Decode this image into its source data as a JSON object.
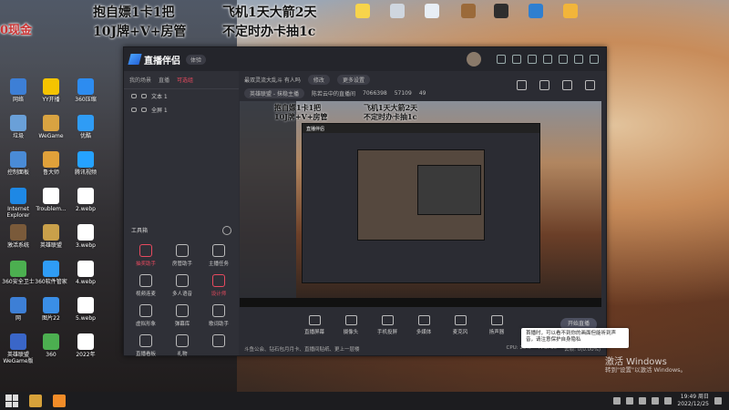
{
  "promo": {
    "line1a": "抱自嫖1卡1把",
    "line1b": "飞机1天大箭2天",
    "line2a": "10J牌+V+房管",
    "line2b": "不定时办卡抽1c",
    "corner": "0现金"
  },
  "desktop_icons": [
    {
      "label": "网络",
      "color": "#3d7fd6"
    },
    {
      "label": "YY开播",
      "color": "#f5c400"
    },
    {
      "label": "360压缩",
      "color": "#2d8cf0"
    },
    {
      "label": "垃圾",
      "color": "#6aa0d8"
    },
    {
      "label": "WeGame",
      "color": "#d9a341"
    },
    {
      "label": "优酷",
      "color": "#2f9cf5"
    },
    {
      "label": "控制面板",
      "color": "#4a8bd6"
    },
    {
      "label": "鲁大师",
      "color": "#e0a13a"
    },
    {
      "label": "腾讯视频",
      "color": "#25a2ff"
    },
    {
      "label": "Internet Explorer",
      "color": "#1e88e5"
    },
    {
      "label": "Troublem...",
      "color": "#ffffff"
    },
    {
      "label": "2.webp",
      "color": "#ffffff"
    },
    {
      "label": "激活系统",
      "color": "#7a5a3a"
    },
    {
      "label": "英雄联盟",
      "color": "#c9a04a"
    },
    {
      "label": "3.webp",
      "color": "#ffffff"
    },
    {
      "label": "360安全卫士",
      "color": "#4caf50"
    },
    {
      "label": "360软件管家",
      "color": "#2f9cf5"
    },
    {
      "label": "4.webp",
      "color": "#ffffff"
    },
    {
      "label": "网",
      "color": "#3d7fd6"
    },
    {
      "label": "图片22",
      "color": "#3a8ee6"
    },
    {
      "label": "5.webp",
      "color": "#ffffff"
    },
    {
      "label": "英雄联盟WeGame版",
      "color": "#3a66c8"
    },
    {
      "label": "360",
      "color": "#4caf50"
    },
    {
      "label": "2022年",
      "color": "#ffffff"
    }
  ],
  "top_icons": [
    {
      "label": "",
      "color": "#f7d44b"
    },
    {
      "label": "",
      "color": "#cfd6df"
    },
    {
      "label": "",
      "color": "#e8eef5"
    },
    {
      "label": "",
      "color": "#9b6a3a"
    },
    {
      "label": "",
      "color": "#2e2e2e"
    },
    {
      "label": "",
      "color": "#2f7fd0"
    },
    {
      "label": "",
      "color": "#f2b53a"
    },
    {
      "label": "",
      "color": "#f2b53a"
    },
    {
      "label": "",
      "color": "#f2b53a"
    },
    {
      "label": "",
      "color": "#f2b53a"
    },
    {
      "label": "",
      "color": "#ffffff"
    },
    {
      "label": "",
      "color": "#39a845"
    }
  ],
  "app": {
    "name": "直播伴侣",
    "badge": "体验",
    "tabs": [
      "我的场景",
      "直播",
      "可选组"
    ],
    "scenes": [
      "文本 1",
      "全屏 1"
    ],
    "tools_header": "工具箱",
    "tools": [
      {
        "label": "抽奖助手",
        "red": true
      },
      {
        "label": "房管助手",
        "red": false
      },
      {
        "label": "主播任务",
        "red": false
      },
      {
        "label": "视频连麦",
        "red": false
      },
      {
        "label": "多人语音",
        "red": false
      },
      {
        "label": "设计师",
        "red": true
      },
      {
        "label": "虚拟形象",
        "red": false
      },
      {
        "label": "弹幕库",
        "red": false
      },
      {
        "label": "歌词助手",
        "red": false
      },
      {
        "label": "直播看板",
        "red": false
      },
      {
        "label": "礼物",
        "red": false
      },
      {
        "label": "",
        "red": false
      }
    ],
    "room_title": "最双灵流大乱斗 有人吗",
    "edit_label": "修改",
    "more_label": "更多设置",
    "category": "英雄联盟 - 抹稳主播",
    "room_info": "陈若云中的直播间",
    "room_id": "7066398",
    "fans": "57109",
    "online": "49",
    "controls": [
      "直播屏幕",
      "摄像头",
      "手机投屏",
      "多媒体",
      "麦克风",
      "扬声器"
    ],
    "start_label": "开始直播",
    "status_left": "斗鱼公会、钻石包月月卡、直播间贴纸、更上一层楼",
    "stats": [
      "CPU: 20%",
      "FPS: 30",
      "丢帧: 0(0.00%)"
    ]
  },
  "tooltip": "首播时，可以看不到你的画面但能听到声音，请注意保护自身隐私",
  "activation": {
    "title": "激活 Windows",
    "subtitle": "转到\"设置\"以激活 Windows。"
  },
  "clock": {
    "time": "19:49 周日",
    "date": "2022/12/25"
  }
}
